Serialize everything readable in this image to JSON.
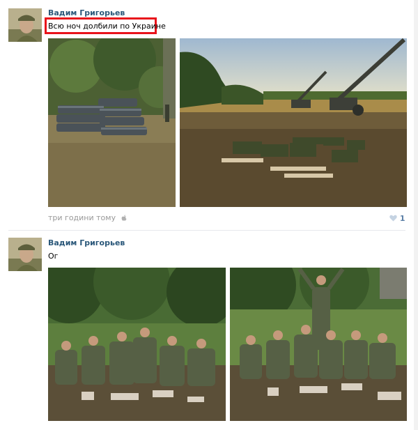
{
  "posts": [
    {
      "author": "Вадим Григорьев",
      "text": "Всю ноч долбили по Украине",
      "time": "три години тому",
      "likes": "1",
      "photos": [
        "shell-casings-photo",
        "artillery-field-photo"
      ]
    },
    {
      "author": "Вадим Григорьев",
      "text": "Ог",
      "photos": [
        "soldiers-group-photo-1",
        "soldiers-group-photo-2"
      ]
    }
  ],
  "colors": {
    "author": "#2b587a",
    "highlight": "#e8131b",
    "meta": "#999999",
    "like": "#5b7fa6"
  },
  "icons": [
    "apple-icon",
    "heart-icon"
  ]
}
